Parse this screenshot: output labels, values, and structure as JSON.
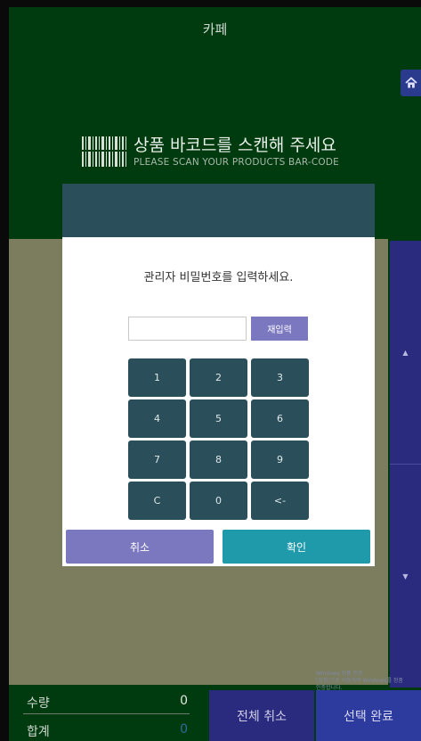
{
  "header": {
    "title": "카페",
    "home_icon": "home-icon"
  },
  "scan": {
    "main": "상품 바코드를 스캔해 주세요",
    "sub": "PLEASE SCAN YOUR PRODUCTS BAR-CODE",
    "icon": "barcode-icon"
  },
  "nav": {
    "up": "▲",
    "down": "▼"
  },
  "footer": {
    "qty_label": "수량",
    "qty_value": "0",
    "total_label": "합계",
    "total_value": "0",
    "cancel_all": "전체 취소",
    "complete": "선택 완료"
  },
  "watermark": {
    "line1": "Windows 정품 인증",
    "line2": "[설정]으로 이동하여 Windows를 정품",
    "line3": "인증합니다."
  },
  "modal": {
    "message": "관리자 비밀번호를 입력하세요.",
    "password_value": "",
    "reenter": "재입력",
    "keys": [
      "1",
      "2",
      "3",
      "4",
      "5",
      "6",
      "7",
      "8",
      "9",
      "C",
      "0",
      "<-"
    ],
    "cancel": "취소",
    "confirm": "확인"
  },
  "colors": {
    "background": "#003b10",
    "keypad": "#2a4f5a",
    "purple": "#7b78c0",
    "teal": "#1f9aaa",
    "nav": "#2a2a7e"
  }
}
